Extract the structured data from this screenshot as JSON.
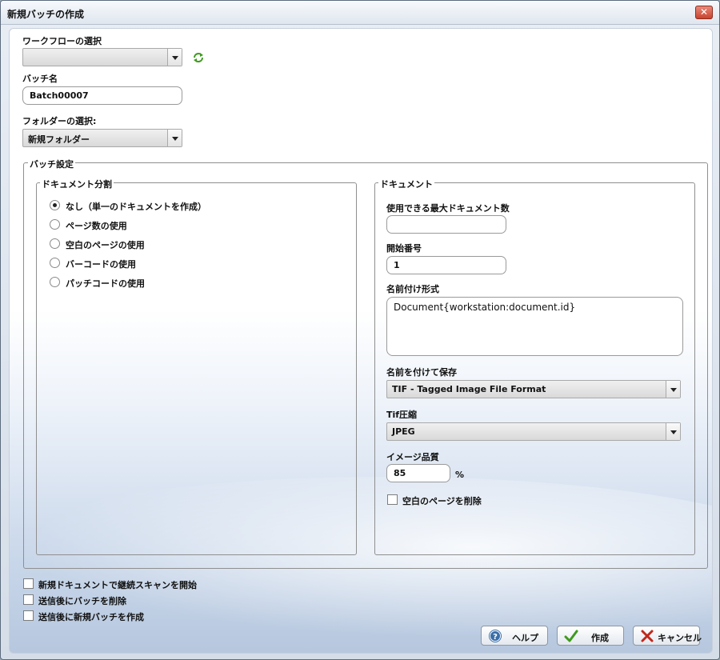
{
  "window": {
    "title": "新規バッチの作成",
    "close_symbol": "✕"
  },
  "workflow": {
    "label": "ワークフローの選択",
    "value": ""
  },
  "batch_name": {
    "label": "バッチ名",
    "value": "Batch00007"
  },
  "folder": {
    "label": "フォルダーの選択:",
    "value": "新規フォルダー"
  },
  "batch_settings": {
    "title": "バッチ設定",
    "doc_split": {
      "title": "ドキュメント分割",
      "options": [
        {
          "label": "なし（単一のドキュメントを作成）",
          "checked": true
        },
        {
          "label": "ページ数の使用",
          "checked": false
        },
        {
          "label": "空白のページの使用",
          "checked": false
        },
        {
          "label": "バーコードの使用",
          "checked": false
        },
        {
          "label": "パッチコードの使用",
          "checked": false
        }
      ]
    },
    "document": {
      "title": "ドキュメント",
      "max_docs": {
        "label": "使用できる最大ドキュメント数",
        "value": ""
      },
      "start_number": {
        "label": "開始番号",
        "value": "1"
      },
      "naming_format": {
        "label": "名前付け形式",
        "value": "Document{workstation:document.id}"
      },
      "save_as": {
        "label": "名前を付けて保存",
        "value": "TIF - Tagged Image File Format"
      },
      "tif_compression": {
        "label": "Tif圧縮",
        "value": "JPEG"
      },
      "image_quality": {
        "label": "イメージ品質",
        "value": "85",
        "unit": "%"
      },
      "delete_blank": {
        "label": "空白のページを削除",
        "checked": false
      }
    }
  },
  "options": [
    {
      "label": "新規ドキュメントで継続スキャンを開始",
      "checked": false
    },
    {
      "label": "送信後にバッチを削除",
      "checked": false
    },
    {
      "label": "送信後に新規バッチを作成",
      "checked": false
    }
  ],
  "buttons": {
    "help": "ヘルプ",
    "create": "作成",
    "cancel": "キャンセル"
  },
  "colors": {
    "accent_green": "#3f9a1e",
    "cancel_red": "#c0281c",
    "help_blue": "#3a6ea8"
  }
}
